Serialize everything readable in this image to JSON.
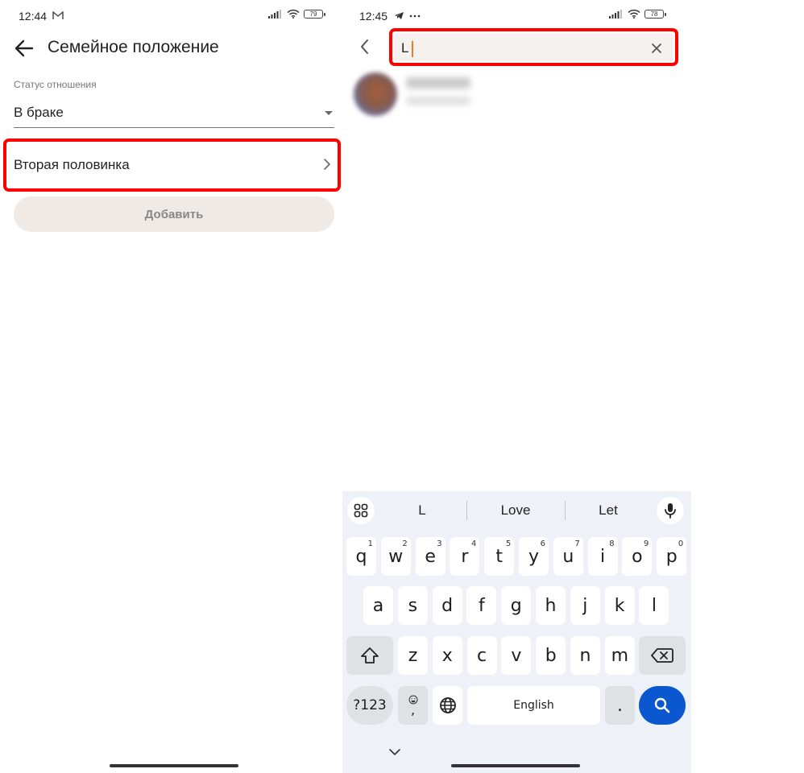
{
  "left_screen": {
    "status_bar": {
      "time": "12:44",
      "notification_icon": "gmail-icon",
      "battery": "79"
    },
    "header": {
      "back_icon": "arrow-left-icon",
      "title": "Семейное положение"
    },
    "relationship_field": {
      "label": "Статус отношения",
      "value": "В браке"
    },
    "partner_row": {
      "label": "Вторая половинка"
    },
    "add_button": {
      "label": "Добавить"
    }
  },
  "right_screen": {
    "status_bar": {
      "time": "12:45",
      "notification_icons": [
        "telegram-icon",
        "more-dots-icon"
      ],
      "battery": "78"
    },
    "search": {
      "value": "L",
      "placeholder": ""
    },
    "results": [
      {
        "name": "",
        "subtitle": ""
      }
    ],
    "keyboard": {
      "suggestions": [
        "L",
        "Love",
        "Let"
      ],
      "row1": [
        {
          "key": "q",
          "hint": "1"
        },
        {
          "key": "w",
          "hint": "2"
        },
        {
          "key": "e",
          "hint": "3"
        },
        {
          "key": "r",
          "hint": "4"
        },
        {
          "key": "t",
          "hint": "5"
        },
        {
          "key": "y",
          "hint": "6"
        },
        {
          "key": "u",
          "hint": "7"
        },
        {
          "key": "i",
          "hint": "8"
        },
        {
          "key": "o",
          "hint": "9"
        },
        {
          "key": "p",
          "hint": "0"
        }
      ],
      "row2": [
        "a",
        "s",
        "d",
        "f",
        "g",
        "h",
        "j",
        "k",
        "l"
      ],
      "row3": [
        "z",
        "x",
        "c",
        "v",
        "b",
        "n",
        "m"
      ],
      "symbols_label": "?123",
      "comma_label": ",",
      "space_label": "English",
      "period_label": ".",
      "accent_color": "#0b57d0"
    }
  },
  "highlight_color": "#ff0000"
}
